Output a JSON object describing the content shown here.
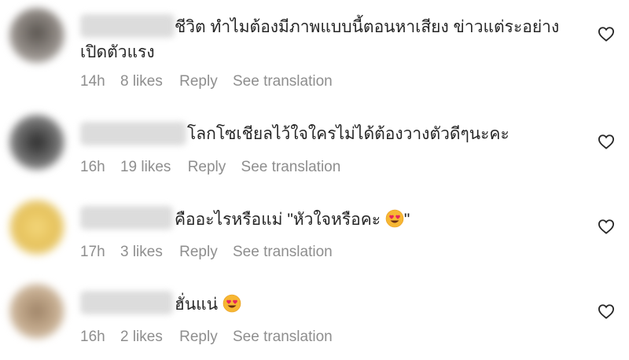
{
  "comments": [
    {
      "text_line1": "ชีวิต ทำไมต้องมีภาพแบบนี้ตอนหาเสียง ข่าวแต่ระอย่าง",
      "text_line2": "เปิดตัวแรง",
      "time": "14h",
      "likes": "8 likes",
      "reply": "Reply",
      "translate": "See translation",
      "avatar_color": "#6e6a66"
    },
    {
      "text": "โลกโซเชียลไว้ใจใครไม่ได้ต้องวางตัวดีๆนะคะ",
      "time": "16h",
      "likes": "19 likes",
      "reply": "Reply",
      "translate": "See translation",
      "avatar_color": "#4a4a4a"
    },
    {
      "text": "คืออะไรหรือแม่ \"หัวใจหรือคะ",
      "text_suffix": "\"",
      "time": "17h",
      "likes": "3 likes",
      "reply": "Reply",
      "translate": "See translation",
      "avatar_color": "#e8c66a"
    },
    {
      "text": "ฮั่นแน่",
      "time": "16h",
      "likes": "2 likes",
      "reply": "Reply",
      "translate": "See translation",
      "avatar_color": "#b29a7e"
    }
  ],
  "icons": {
    "like": "heart-outline-icon",
    "emoji": "heart-eyes-emoji"
  }
}
